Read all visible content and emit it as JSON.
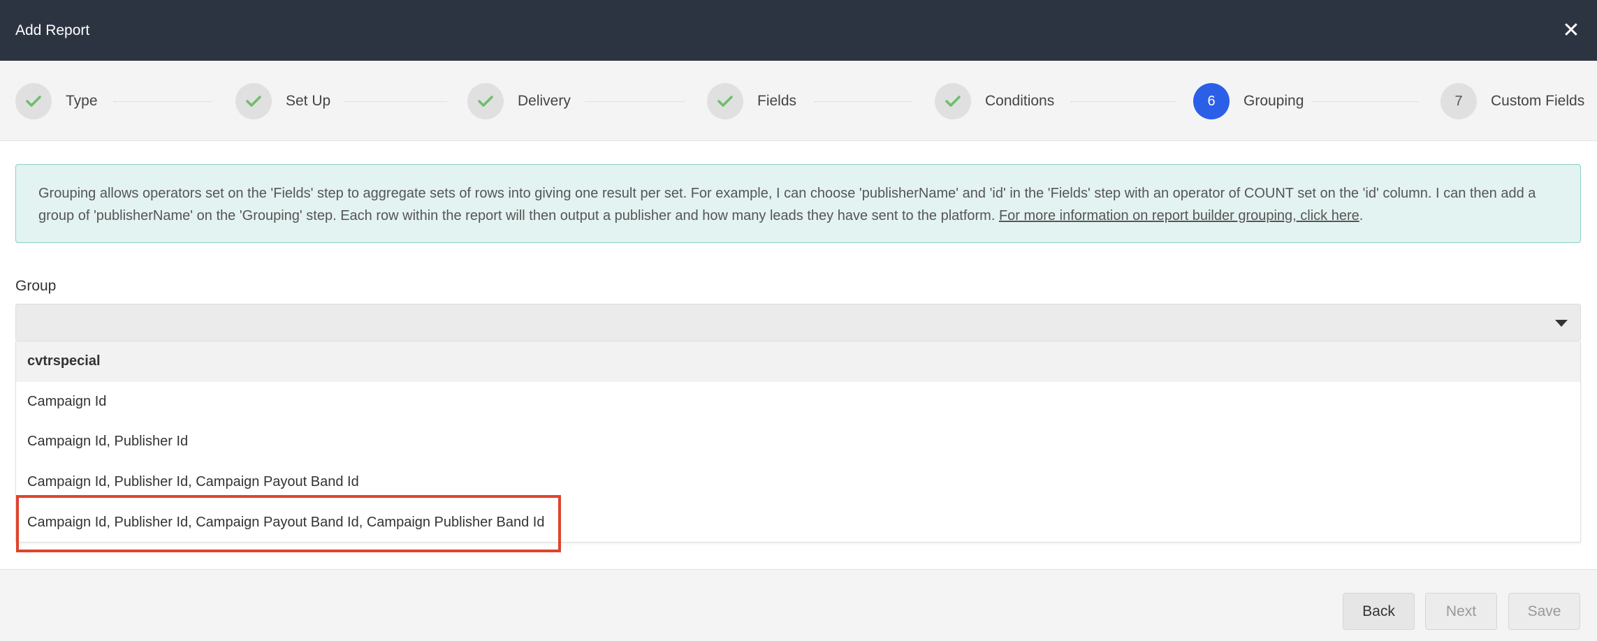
{
  "window": {
    "title": "Add Report",
    "close_icon": "close-icon"
  },
  "steps": [
    {
      "label": "Type",
      "state": "done"
    },
    {
      "label": "Set Up",
      "state": "done"
    },
    {
      "label": "Delivery",
      "state": "done"
    },
    {
      "label": "Fields",
      "state": "done"
    },
    {
      "label": "Conditions",
      "state": "done"
    },
    {
      "label": "Grouping",
      "state": "active",
      "number": "6"
    },
    {
      "label": "Custom Fields",
      "state": "pending",
      "number": "7"
    }
  ],
  "info": {
    "text": "Grouping allows operators set on the 'Fields' step to aggregate sets of rows into giving one result per set. For example, I can choose 'publisherName' and 'id' in the 'Fields' step with an operator of COUNT set on the 'id' column. I can then add a group of 'publisherName' on the 'Grouping' step. Each row within the report will then output a publisher and how many leads they have sent to the platform. ",
    "link": "For more information on report builder grouping, click here",
    "trailing": "."
  },
  "group": {
    "label": "Group",
    "value": "",
    "options": [
      "cvtrspecial",
      "Campaign Id",
      "Campaign Id, Publisher Id",
      "Campaign Id, Publisher Id, Campaign Payout Band Id",
      "Campaign Id, Publisher Id, Campaign Payout Band Id, Campaign Publisher Band Id"
    ]
  },
  "footer": {
    "back": "Back",
    "next": "Next",
    "save": "Save"
  },
  "colors": {
    "titlebar": "#2d3441",
    "active_step": "#2c5fe8",
    "check": "#6cbf6a",
    "info_bg": "#e3f3f1",
    "highlight_box": "#e0442c"
  }
}
